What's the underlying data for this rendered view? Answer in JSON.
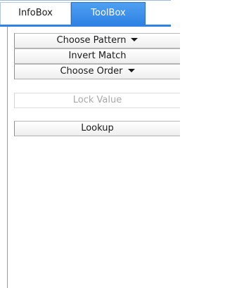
{
  "tabs": {
    "infobox_label": "InfoBox",
    "toolbox_label": "ToolBox"
  },
  "toolbox": {
    "choose_pattern_label": "Choose Pattern",
    "invert_match_label": "Invert Match",
    "choose_order_label": "Choose Order",
    "lock_value_label": "Lock Value",
    "lookup_label": "Lookup"
  },
  "colors": {
    "active_tab": "#2f81e3",
    "accent_bar": "#2f81e3"
  },
  "icons": {
    "dropdown_caret": "chevron-down-icon"
  }
}
